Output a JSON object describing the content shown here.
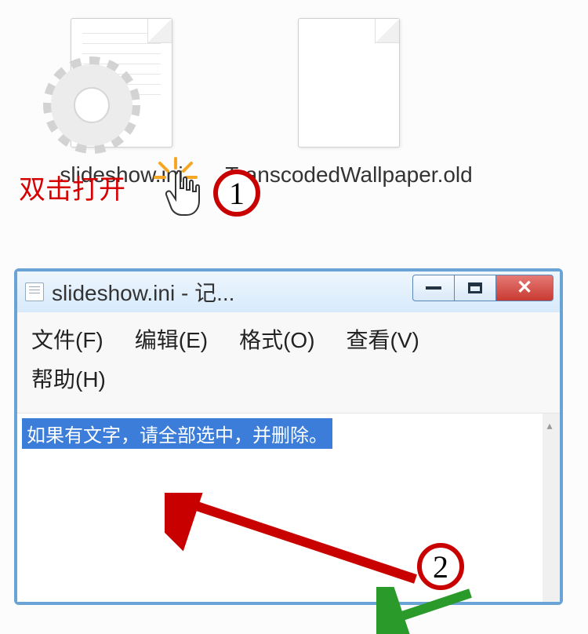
{
  "files": [
    {
      "name": "slideshow.ini",
      "icon": "ini-gear"
    },
    {
      "name": "TranscodedWallpaper.old",
      "icon": "blank"
    }
  ],
  "annot": {
    "double_click": "双击打开",
    "badge1": "1",
    "badge2": "2"
  },
  "notepad": {
    "title": "slideshow.ini - 记...",
    "menu": {
      "file": "文件(F)",
      "edit": "编辑(E)",
      "format": "格式(O)",
      "view": "查看(V)",
      "help": "帮助(H)"
    },
    "selected_text": "如果有文字，请全部选中，并删除。"
  }
}
